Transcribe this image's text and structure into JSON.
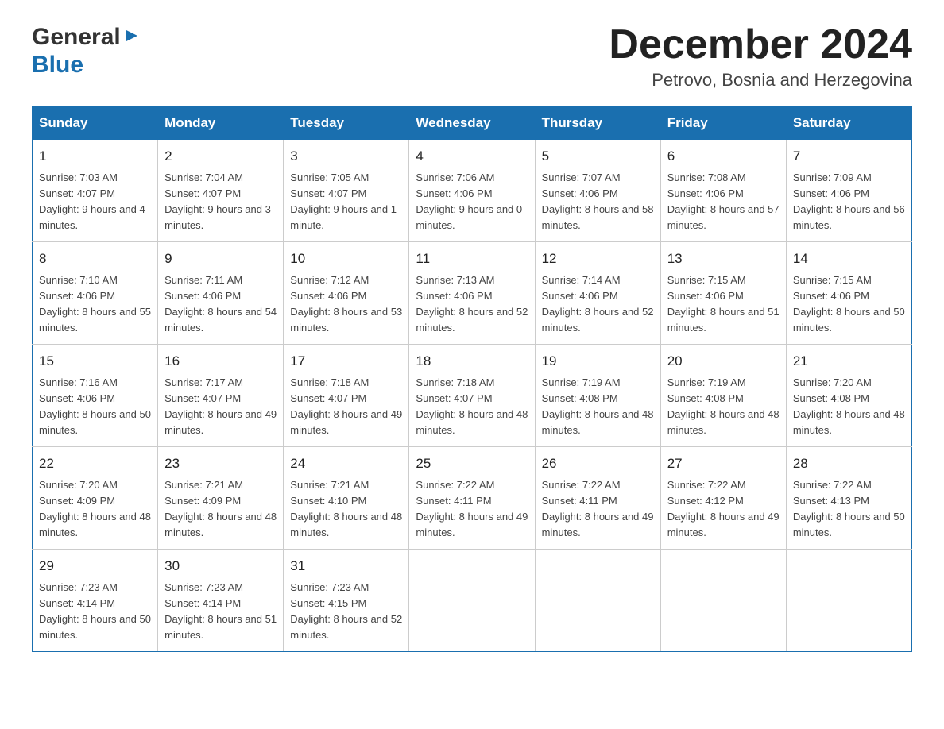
{
  "header": {
    "logo_general": "General",
    "logo_blue": "Blue",
    "month_title": "December 2024",
    "location": "Petrovo, Bosnia and Herzegovina"
  },
  "calendar": {
    "days_of_week": [
      "Sunday",
      "Monday",
      "Tuesday",
      "Wednesday",
      "Thursday",
      "Friday",
      "Saturday"
    ],
    "weeks": [
      [
        {
          "day": "1",
          "sunrise": "7:03 AM",
          "sunset": "4:07 PM",
          "daylight": "9 hours and 4 minutes."
        },
        {
          "day": "2",
          "sunrise": "7:04 AM",
          "sunset": "4:07 PM",
          "daylight": "9 hours and 3 minutes."
        },
        {
          "day": "3",
          "sunrise": "7:05 AM",
          "sunset": "4:07 PM",
          "daylight": "9 hours and 1 minute."
        },
        {
          "day": "4",
          "sunrise": "7:06 AM",
          "sunset": "4:06 PM",
          "daylight": "9 hours and 0 minutes."
        },
        {
          "day": "5",
          "sunrise": "7:07 AM",
          "sunset": "4:06 PM",
          "daylight": "8 hours and 58 minutes."
        },
        {
          "day": "6",
          "sunrise": "7:08 AM",
          "sunset": "4:06 PM",
          "daylight": "8 hours and 57 minutes."
        },
        {
          "day": "7",
          "sunrise": "7:09 AM",
          "sunset": "4:06 PM",
          "daylight": "8 hours and 56 minutes."
        }
      ],
      [
        {
          "day": "8",
          "sunrise": "7:10 AM",
          "sunset": "4:06 PM",
          "daylight": "8 hours and 55 minutes."
        },
        {
          "day": "9",
          "sunrise": "7:11 AM",
          "sunset": "4:06 PM",
          "daylight": "8 hours and 54 minutes."
        },
        {
          "day": "10",
          "sunrise": "7:12 AM",
          "sunset": "4:06 PM",
          "daylight": "8 hours and 53 minutes."
        },
        {
          "day": "11",
          "sunrise": "7:13 AM",
          "sunset": "4:06 PM",
          "daylight": "8 hours and 52 minutes."
        },
        {
          "day": "12",
          "sunrise": "7:14 AM",
          "sunset": "4:06 PM",
          "daylight": "8 hours and 52 minutes."
        },
        {
          "day": "13",
          "sunrise": "7:15 AM",
          "sunset": "4:06 PM",
          "daylight": "8 hours and 51 minutes."
        },
        {
          "day": "14",
          "sunrise": "7:15 AM",
          "sunset": "4:06 PM",
          "daylight": "8 hours and 50 minutes."
        }
      ],
      [
        {
          "day": "15",
          "sunrise": "7:16 AM",
          "sunset": "4:06 PM",
          "daylight": "8 hours and 50 minutes."
        },
        {
          "day": "16",
          "sunrise": "7:17 AM",
          "sunset": "4:07 PM",
          "daylight": "8 hours and 49 minutes."
        },
        {
          "day": "17",
          "sunrise": "7:18 AM",
          "sunset": "4:07 PM",
          "daylight": "8 hours and 49 minutes."
        },
        {
          "day": "18",
          "sunrise": "7:18 AM",
          "sunset": "4:07 PM",
          "daylight": "8 hours and 48 minutes."
        },
        {
          "day": "19",
          "sunrise": "7:19 AM",
          "sunset": "4:08 PM",
          "daylight": "8 hours and 48 minutes."
        },
        {
          "day": "20",
          "sunrise": "7:19 AM",
          "sunset": "4:08 PM",
          "daylight": "8 hours and 48 minutes."
        },
        {
          "day": "21",
          "sunrise": "7:20 AM",
          "sunset": "4:08 PM",
          "daylight": "8 hours and 48 minutes."
        }
      ],
      [
        {
          "day": "22",
          "sunrise": "7:20 AM",
          "sunset": "4:09 PM",
          "daylight": "8 hours and 48 minutes."
        },
        {
          "day": "23",
          "sunrise": "7:21 AM",
          "sunset": "4:09 PM",
          "daylight": "8 hours and 48 minutes."
        },
        {
          "day": "24",
          "sunrise": "7:21 AM",
          "sunset": "4:10 PM",
          "daylight": "8 hours and 48 minutes."
        },
        {
          "day": "25",
          "sunrise": "7:22 AM",
          "sunset": "4:11 PM",
          "daylight": "8 hours and 49 minutes."
        },
        {
          "day": "26",
          "sunrise": "7:22 AM",
          "sunset": "4:11 PM",
          "daylight": "8 hours and 49 minutes."
        },
        {
          "day": "27",
          "sunrise": "7:22 AM",
          "sunset": "4:12 PM",
          "daylight": "8 hours and 49 minutes."
        },
        {
          "day": "28",
          "sunrise": "7:22 AM",
          "sunset": "4:13 PM",
          "daylight": "8 hours and 50 minutes."
        }
      ],
      [
        {
          "day": "29",
          "sunrise": "7:23 AM",
          "sunset": "4:14 PM",
          "daylight": "8 hours and 50 minutes."
        },
        {
          "day": "30",
          "sunrise": "7:23 AM",
          "sunset": "4:14 PM",
          "daylight": "8 hours and 51 minutes."
        },
        {
          "day": "31",
          "sunrise": "7:23 AM",
          "sunset": "4:15 PM",
          "daylight": "8 hours and 52 minutes."
        },
        null,
        null,
        null,
        null
      ]
    ]
  }
}
